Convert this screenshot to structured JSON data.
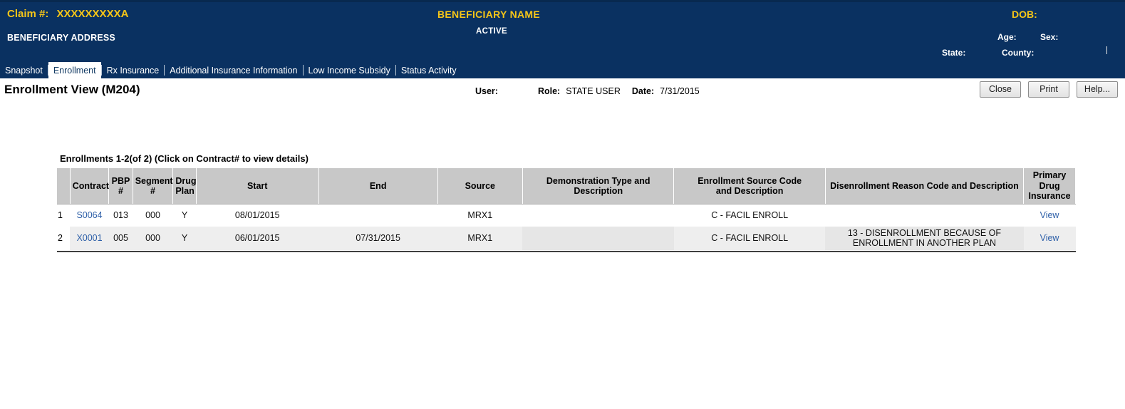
{
  "banner": {
    "claim_label": "Claim #:",
    "claim_value": "XXXXXXXXXA",
    "beneficiary_address": "BENEFICIARY ADDRESS",
    "beneficiary_name": "BENEFICIARY NAME",
    "status": "ACTIVE",
    "dob_label": "DOB:",
    "age_label": "Age:",
    "sex_label": "Sex:",
    "state_label": "State:",
    "county_label": "County:",
    "bg_color": "#0a3161",
    "accent_color": "#f5c518"
  },
  "tabs": [
    {
      "label": "Snapshot",
      "active": false
    },
    {
      "label": "Enrollment",
      "active": true
    },
    {
      "label": "Rx Insurance",
      "active": false
    },
    {
      "label": "Additional Insurance Information",
      "active": false
    },
    {
      "label": "Low Income Subsidy",
      "active": false
    },
    {
      "label": "Status Activity",
      "active": false
    }
  ],
  "toolbar": {
    "page_title": "Enrollment View (M204)",
    "user_label": "User:",
    "user_value": "",
    "role_label": "Role:",
    "role_value": "STATE USER",
    "date_label": "Date:",
    "date_value": "7/31/2015",
    "close_label": "Close",
    "print_label": "Print",
    "help_label": "Help..."
  },
  "table": {
    "caption": "Enrollments 1-2(of 2) (Click on Contract# to view details)",
    "columns": [
      "",
      "Contract",
      "PBP #",
      "Segment #",
      "Drug Plan",
      "Start",
      "End",
      "Source",
      "Demonstration Type and Description",
      "Enrollment Source Code and Description",
      "Disenrollment Reason Code and Description",
      "Primary Drug Insurance"
    ],
    "columns_html": [
      "",
      "Contract",
      "PBP<br>#",
      "Segment<br>#",
      "Drug<br>Plan",
      "Start",
      "End",
      "Source",
      "Demonstration Type and<br>Description",
      "Enrollment Source Code<br>and Description",
      "Disenrollment Reason Code and Description",
      "Primary<br>Drug<br>Insurance"
    ],
    "rows": [
      {
        "index": "1",
        "contract": "S0064",
        "pbp": "013",
        "segment": "000",
        "drug_plan": "Y",
        "start": "08/01/2015",
        "end": "",
        "source": "MRX1",
        "demonstration": "",
        "enrollment_source": "C - FACIL ENROLL",
        "disenrollment_reason": "",
        "primary_drug_insurance": "View"
      },
      {
        "index": "2",
        "contract": "X0001",
        "pbp": "005",
        "segment": "000",
        "drug_plan": "Y",
        "start": "06/01/2015",
        "end": "07/31/2015",
        "source": "MRX1",
        "demonstration": "",
        "enrollment_source": "C - FACIL ENROLL",
        "disenrollment_reason": "13 - DISENROLLMENT BECAUSE OF ENROLLMENT IN ANOTHER PLAN",
        "primary_drug_insurance": "View"
      }
    ]
  }
}
